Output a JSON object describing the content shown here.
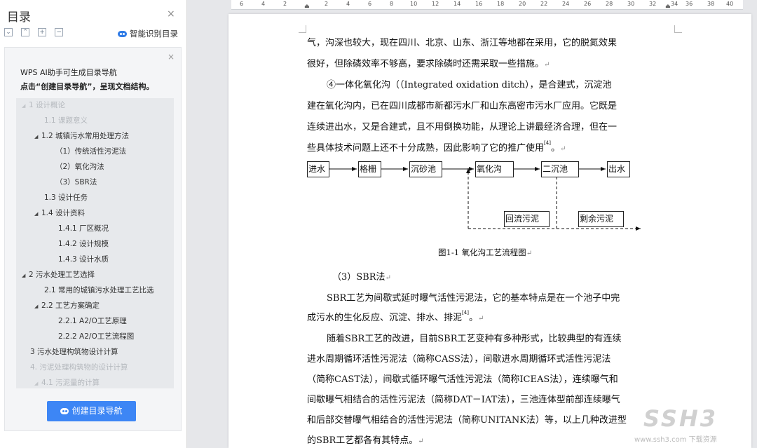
{
  "nav": {
    "title": "目录",
    "close": "×",
    "tools": [
      "⌄",
      "⌃",
      "+",
      "−"
    ],
    "smart_label": "智能识别目录",
    "panel_close": "×",
    "ai_line1": "WPS AI助手可生成目录导航",
    "ai_line2": "点击“创建目录导航”，呈现文档结构。",
    "create_button": "创建目录导航",
    "toc": [
      {
        "level": 1,
        "arrow": "◢",
        "label": "1 设计概论",
        "faded": true
      },
      {
        "level": 2,
        "arrow": "",
        "label": "1.1 课题意义",
        "faded": true
      },
      {
        "level": 2,
        "arrow": "◢",
        "label": "1.2 城镇污水常用处理方法",
        "faded": false
      },
      {
        "level": 3,
        "arrow": "",
        "label": "（1）传统活性污泥法",
        "faded": false
      },
      {
        "level": 3,
        "arrow": "",
        "label": "（2）氧化沟法",
        "faded": false
      },
      {
        "level": 3,
        "arrow": "",
        "label": "（3）SBR法",
        "faded": false
      },
      {
        "level": 2,
        "arrow": "",
        "label": "1.3 设计任务",
        "faded": false
      },
      {
        "level": 2,
        "arrow": "◢",
        "label": "1.4 设计资料",
        "faded": false
      },
      {
        "level": 3,
        "arrow": "",
        "label": "1.4.1 厂区概况",
        "faded": false
      },
      {
        "level": 3,
        "arrow": "",
        "label": "1.4.2 设计规模",
        "faded": false
      },
      {
        "level": 3,
        "arrow": "",
        "label": "1.4.3 设计水质",
        "faded": false
      },
      {
        "level": 1,
        "arrow": "◢",
        "label": "2 污水处理工艺选择",
        "faded": false
      },
      {
        "level": 2,
        "arrow": "",
        "label": "2.1 常用的城镇污水处理工艺比选",
        "faded": false
      },
      {
        "level": 2,
        "arrow": "◢",
        "label": "2.2 工艺方案确定",
        "faded": false
      },
      {
        "level": 3,
        "arrow": "",
        "label": "2.2.1 A2/O工艺原理",
        "faded": false
      },
      {
        "level": 3,
        "arrow": "",
        "label": "2.2.2 A2/O工艺流程图",
        "faded": false
      },
      {
        "level": 1,
        "arrow": "",
        "label": "3 污水处理构筑物设计计算",
        "faded": false
      },
      {
        "level": 1,
        "arrow": "",
        "label": "4. 污泥处理构筑物的设计计算",
        "faded": true
      },
      {
        "level": 2,
        "arrow": "◢",
        "label": "4.1 污泥量的计算",
        "faded": true
      }
    ]
  },
  "ruler": {
    "labels": [
      "6",
      "4",
      "2",
      "2",
      "4",
      "6",
      "8",
      "10",
      "12",
      "14",
      "16",
      "18",
      "20",
      "22",
      "24",
      "26",
      "28",
      "30",
      "32",
      "34",
      "36",
      "38",
      "40"
    ]
  },
  "doc": {
    "lines": [
      "气，沟深也较大，现在四川、北京、山东、浙江等地都在采用，它的脱氮效果",
      "很好，但除磷效率不够高，要求除磷时还需采取一些措施。",
      "④一体化氧化沟（（Integrated oxidation ditch），是合建式，沉淀池",
      "建在氧化沟内，已在四川成都市新都污水厂和山东高密市污水厂应用。它既是",
      "连续进出水，又是合建式，且不用倒换功能，从理论上讲最经济合理，但在一",
      "些具体技术问题上还不十分成熟，因此影响了它的推广使用",
      "（3）SBR法",
      "SBR工艺为间歇式延时曝气活性污泥法，它的基本特点是在一个池子中完",
      "成污水的生化反应、沉淀、排水、排泥",
      "随着SBR工艺的改进，目前SBR工艺变种有多种形式，比较典型的有连续",
      "进水周期循环活性污泥法（简称CASS法），间歇进水周期循环式活性污泥法",
      "（简称CAST法），间歇式循环曝气活性污泥法（简称ICEAS法），连续曝气和",
      "间歇曝气相结合的活性污泥法（简称DAT－IAT法），三池连体型前部连续曝气",
      "和后部交替曝气相结合的活性污泥法（简称UNITANK法）等，以上几种改进型",
      "的SBR工艺都各有其特点。"
    ],
    "ref4": "[4]",
    "para_mark": "↵",
    "flow": {
      "boxes": [
        "进水",
        "格栅",
        "沉砂池",
        "氧化沟",
        "二沉池",
        "出水",
        "回流污泥",
        "剩余污泥"
      ],
      "caption": "图1-1 氧化沟工艺流程图"
    }
  },
  "watermark": {
    "brand": "SSH3",
    "sub": "www.ssh3.com 下载资源"
  }
}
